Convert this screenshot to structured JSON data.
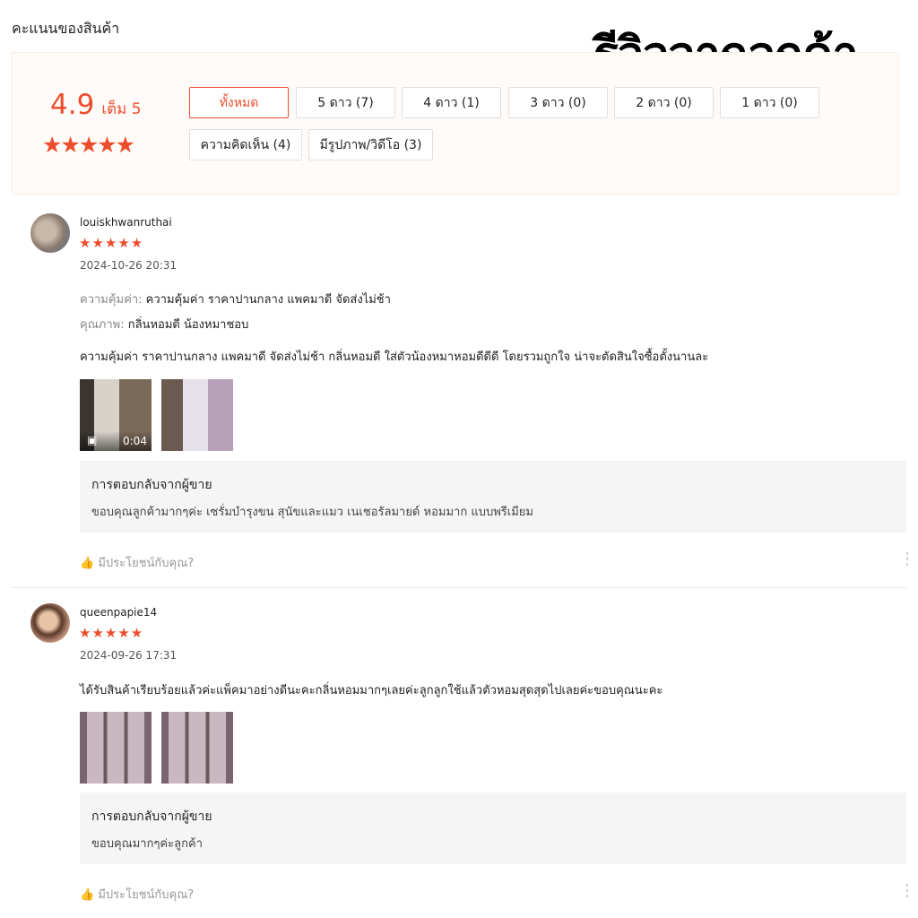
{
  "section_title": "คะแนนของสินค้า",
  "banner_title": "รีวิวจากลูกค้า",
  "overview": {
    "score": "4.9",
    "out_of": "เต็ม 5",
    "stars": "★★★★★"
  },
  "filters": [
    "ทั้งหมด",
    "5 ดาว (7)",
    "4 ดาว (1)",
    "3 ดาว (0)",
    "2 ดาว (0)",
    "1 ดาว (0)",
    "ความคิดเห็น (4)",
    "มีรูปภาพ/วิดีโอ (3)"
  ],
  "active_filter": "ทั้งหมด",
  "accent_color": "#ee4d2d",
  "reviews": [
    {
      "username": "louiskhwanruthai",
      "stars": "★★★★★",
      "rating": 5,
      "date": "2024-10-26 20:31",
      "attributes": [
        {
          "key": "ความคุ้มค่า:",
          "value": "ความคุ้มค่า ราคาปานกลาง แพคมาดี จัดส่งไม่ช้า"
        },
        {
          "key": "คุณภาพ:",
          "value": "กลิ่นหอมดี น้องหมาชอบ"
        }
      ],
      "comment": "ความคุ้มค่า ราคาปานกลาง แพคมาดี จัดส่งไม่ช้า กลิ่นหอมดี  ใส่ตัวน้องหมาหอมดีดีดี โดยรวมถูกใจ น่าจะตัดสินใจซื้อตั้งนานละ",
      "video_duration": "0:04",
      "reply_title": "การตอบกลับจากผู้ขาย",
      "reply_text": "ขอบคุณลูกค้ามากๆค่ะ  เซรั่มบำรุงขน สุนัขและแมว  เนเชอรัลมายด์ หอมมาก แบบพรีเมียม",
      "helpful": "มีประโยชน์กับคุณ?"
    },
    {
      "username": "queenpapie14",
      "stars": "★★★★★",
      "rating": 5,
      "date": "2024-09-26 17:31",
      "comment": "ได้รับสินค้าเรียบร้อยแล้วค่ะแพ็คมาอย่างดีนะคะกลิ่นหอมมากๆเลยค่ะลูกลูกใช้แล้วตัวหอมสุดสุดไปเลยค่ะขอบคุณนะคะ",
      "reply_title": "การตอบกลับจากผู้ขาย",
      "reply_text": "ขอบคุณมากๆค่ะลูกค้า",
      "helpful": "มีประโยชน์กับคุณ?"
    }
  ]
}
